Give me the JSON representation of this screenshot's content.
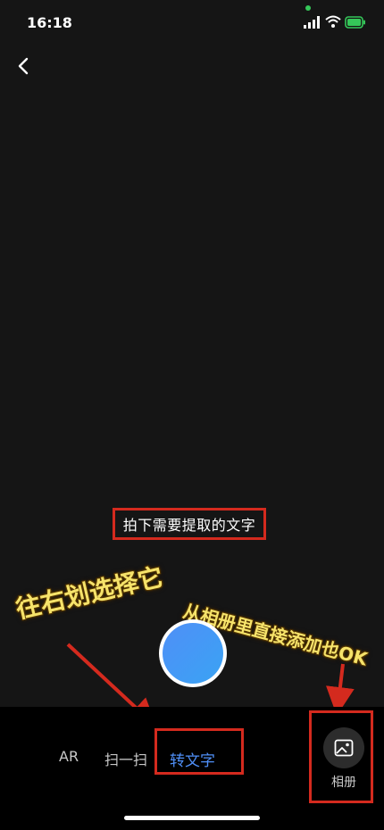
{
  "status_bar": {
    "time": "16:18",
    "icons": [
      "signal-icon",
      "wifi-icon",
      "battery-icon"
    ]
  },
  "navigation": {
    "back_icon": "chevron-left-icon"
  },
  "camera": {
    "hint": "拍下需要提取的文字"
  },
  "annotations": {
    "swipe_right": "往右划选择它",
    "from_album": "从相册里直接添加也OK"
  },
  "mode_bar": {
    "tabs": [
      {
        "label": "AR",
        "active": false
      },
      {
        "label": "扫一扫",
        "active": false
      },
      {
        "label": "转文字",
        "active": true
      }
    ],
    "album_label": "相册",
    "album_icon": "photo-album-icon"
  },
  "colors": {
    "active_tab": "#4f8ff7",
    "shutter": "#4f8ff7",
    "highlight_box": "#d42a1e",
    "annotation_text": "#f6e36a",
    "battery": "#35c759"
  }
}
